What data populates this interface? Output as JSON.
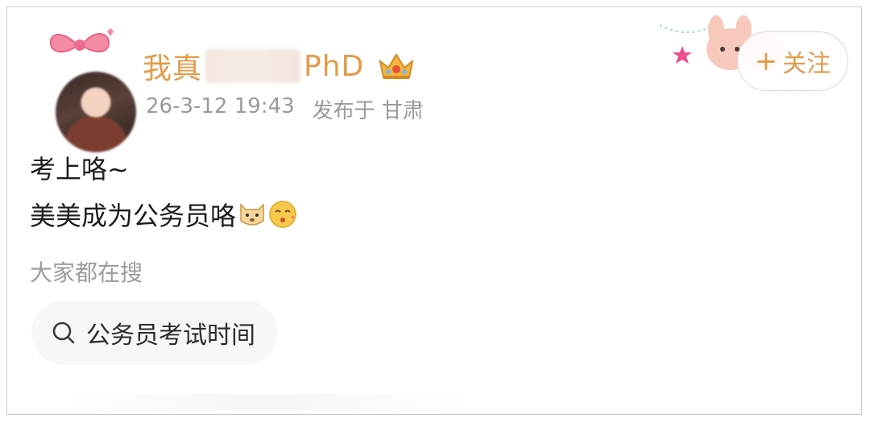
{
  "post": {
    "username_prefix": "我真",
    "username_suffix": "PhD",
    "timestamp": "26-3-12 19:43",
    "location": "发布于 甘肃",
    "follow_label": "关注",
    "follow_plus": "+",
    "line1": "考上咯~",
    "line2": "美美成为公务员咯",
    "emojis": [
      "dog-face-emoji",
      "blowing-kiss-emoji"
    ]
  },
  "search": {
    "hint": "大家都在搜",
    "chip_label": "公务员考试时间",
    "icon": "search-icon"
  },
  "colors": {
    "accent": "#e49a4a",
    "meta_text": "#9a9a9a",
    "chip_bg": "#f7f7f7"
  }
}
